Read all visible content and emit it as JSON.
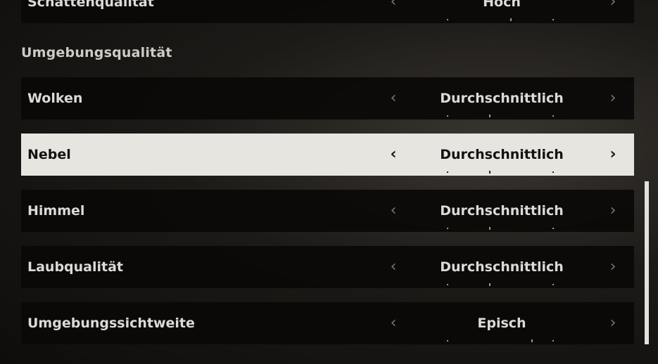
{
  "rows_top": {
    "label": "Schattenqualität",
    "value": "Hoch"
  },
  "section": {
    "title": "Umgebungsqualität"
  },
  "rows": [
    {
      "label": "Wolken",
      "value": "Durchschnittlich"
    },
    {
      "label": "Nebel",
      "value": "Durchschnittlich"
    },
    {
      "label": "Himmel",
      "value": "Durchschnittlich"
    },
    {
      "label": "Laubqualität",
      "value": "Durchschnittlich"
    },
    {
      "label": "Umgebungssichtweite",
      "value": "Episch"
    }
  ],
  "arrows": {
    "left": "‹",
    "right": "›"
  }
}
